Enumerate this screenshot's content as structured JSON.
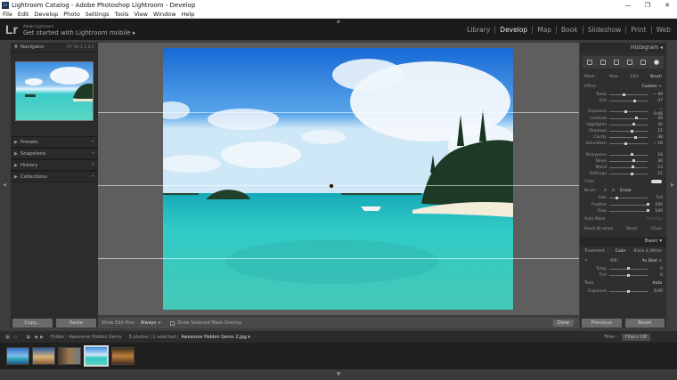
{
  "window": {
    "title": "Lightroom Catalog - Adobe Photoshop Lightroom - Develop",
    "controls": [
      "—",
      "❐",
      "✕"
    ]
  },
  "menu": [
    "File",
    "Edit",
    "Develop",
    "Photo",
    "Settings",
    "Tools",
    "View",
    "Window",
    "Help"
  ],
  "identity": {
    "logo": "Lr",
    "small": "Adobe Lightroom",
    "main": "Get started with Lightroom mobile ▸"
  },
  "modules": [
    "Library",
    "Develop",
    "Map",
    "Book",
    "Slideshow",
    "Print",
    "Web"
  ],
  "left_panel": {
    "navigator": {
      "title": "Navigator",
      "zoom": "FIT   Fill   1:1   4:1"
    },
    "sections": [
      {
        "label": "Presets",
        "action": "+"
      },
      {
        "label": "Snapshots",
        "action": "+"
      },
      {
        "label": "History",
        "action": "×"
      },
      {
        "label": "Collections",
        "action": "+"
      }
    ],
    "copy_label": "Copy...",
    "paste_label": "Paste"
  },
  "toolbar": {
    "show_edit_pins_label": "Show Edit Pins :",
    "show_edit_pins_value": "Always ÷",
    "overlay_label": "Show Selected Mask Overlay",
    "done_label": "Done"
  },
  "right_panel": {
    "histogram_label": "Histogram ◂",
    "mask": {
      "label": "Mask :",
      "new": "New",
      "edit": "Edit",
      "brush": "Brush"
    },
    "effect": {
      "label": "Effect :",
      "value": "Custom ÷"
    },
    "sliders_a": [
      {
        "label": "Temp",
        "value": "− 49",
        "pos": 0.38
      },
      {
        "label": "Tint",
        "value": "47",
        "pos": 0.66
      },
      {
        "label": "Exposure",
        "value": "− 0.66",
        "pos": 0.42
      },
      {
        "label": "Contrast",
        "value": "45",
        "pos": 0.72
      },
      {
        "label": "Highlights",
        "value": "30",
        "pos": 0.65
      },
      {
        "label": "Shadows",
        "value": "21",
        "pos": 0.6
      },
      {
        "label": "Clarity",
        "value": "38",
        "pos": 0.69
      },
      {
        "label": "Saturation",
        "value": "− 16",
        "pos": 0.42
      }
    ],
    "sliders_b": [
      {
        "label": "Sharpness",
        "value": "18",
        "pos": 0.59
      },
      {
        "label": "Noise",
        "value": "30",
        "pos": 0.65
      },
      {
        "label": "Moiré",
        "value": "23",
        "pos": 0.61
      },
      {
        "label": "Defringe",
        "value": "21",
        "pos": 0.6
      }
    ],
    "color_label": "Color",
    "brush": {
      "label": "Brush :",
      "a": "A",
      "b": "B",
      "erase": "Erase"
    },
    "sliders_c": [
      {
        "label": "Size",
        "value": "5.0",
        "pos": 0.2
      },
      {
        "label": "Feather",
        "value": "100",
        "pos": 1.0
      },
      {
        "label": "Flow",
        "value": "100",
        "pos": 1.0
      }
    ],
    "auto_mask_label": "Auto Mask",
    "density_label": "Density",
    "reset_row": {
      "left": "Reset Brushes",
      "mid": "Reset",
      "right": "Close"
    },
    "basic_label": "Basic ▾",
    "treatment": {
      "label": "Treatment :",
      "color": "Color",
      "bw": "Black & White"
    },
    "wb": {
      "label": "WB :",
      "value": "As Shot ÷"
    },
    "sliders_d": [
      {
        "label": "Temp",
        "value": "0",
        "pos": 0.5
      },
      {
        "label": "Tint",
        "value": "0",
        "pos": 0.5
      }
    ],
    "tone": {
      "label": "Tone",
      "auto": "Auto"
    },
    "exposure": {
      "label": "Exposure",
      "value": "0.00",
      "pos": 0.5
    },
    "previous_label": "Previous",
    "reset_label": "Reset"
  },
  "filmbar": {
    "folder": "Folder : Awesome Hidden Gems",
    "count": "5 photos / 1 selected /",
    "file": "Awesome Hidden Gems 2.jpg ▾",
    "filter_label": "Filter :",
    "filter_value": "Filters Off"
  },
  "filmstrip": {
    "count": 5,
    "selected_index": 3
  },
  "colors": {
    "accent": "#e6e6e6",
    "panel": "#2c2c2c",
    "canvas": "#5e5e5e"
  }
}
